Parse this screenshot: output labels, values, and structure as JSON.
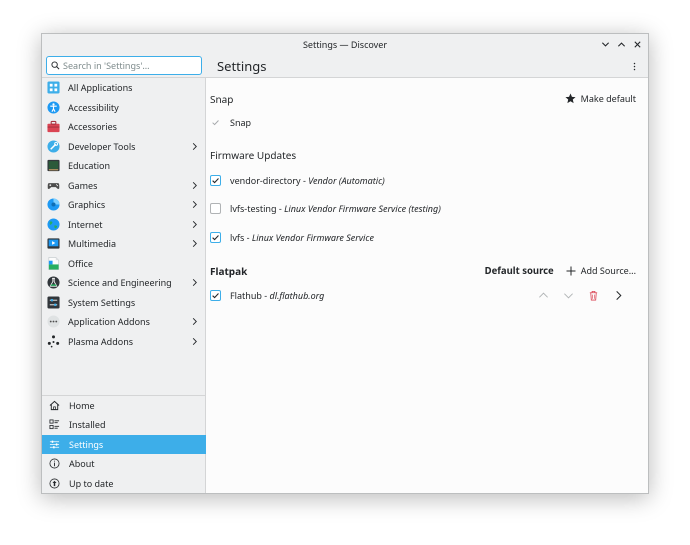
{
  "window": {
    "title": "Settings — Discover"
  },
  "header": {
    "search_placeholder": "Search in 'Settings'...",
    "page_title": "Settings"
  },
  "sidebar": {
    "categories": [
      {
        "label": "All Applications",
        "icon": "all-applications-icon",
        "has_children": false
      },
      {
        "label": "Accessibility",
        "icon": "accessibility-icon",
        "has_children": false
      },
      {
        "label": "Accessories",
        "icon": "accessories-icon",
        "has_children": false
      },
      {
        "label": "Developer Tools",
        "icon": "developer-tools-icon",
        "has_children": true
      },
      {
        "label": "Education",
        "icon": "education-icon",
        "has_children": false
      },
      {
        "label": "Games",
        "icon": "games-icon",
        "has_children": true
      },
      {
        "label": "Graphics",
        "icon": "graphics-icon",
        "has_children": true
      },
      {
        "label": "Internet",
        "icon": "internet-icon",
        "has_children": true
      },
      {
        "label": "Multimedia",
        "icon": "multimedia-icon",
        "has_children": true
      },
      {
        "label": "Office",
        "icon": "office-icon",
        "has_children": false
      },
      {
        "label": "Science and Engineering",
        "icon": "science-icon",
        "has_children": true
      },
      {
        "label": "System Settings",
        "icon": "system-settings-icon",
        "has_children": false
      },
      {
        "label": "Application Addons",
        "icon": "application-addons-icon",
        "has_children": true
      },
      {
        "label": "Plasma Addons",
        "icon": "plasma-addons-icon",
        "has_children": true
      }
    ],
    "nav": [
      {
        "label": "Home",
        "icon": "home-icon",
        "active": false
      },
      {
        "label": "Installed",
        "icon": "installed-icon",
        "active": false
      },
      {
        "label": "Settings",
        "icon": "settings-icon",
        "active": true
      },
      {
        "label": "About",
        "icon": "about-icon",
        "active": false
      },
      {
        "label": "Up to date",
        "icon": "up-to-date-icon",
        "active": false
      }
    ]
  },
  "main": {
    "snap": {
      "title": "Snap",
      "make_default_label": "Make default",
      "sources": [
        {
          "name": "Snap",
          "checked": true,
          "disabled": true
        }
      ]
    },
    "firmware": {
      "title": "Firmware Updates",
      "sources": [
        {
          "name": "vendor-directory",
          "separator": " - ",
          "detail": "Vendor (Automatic)",
          "checked": true
        },
        {
          "name": "lvfs-testing",
          "separator": " - ",
          "detail": "Linux Vendor Firmware Service (testing)",
          "checked": false
        },
        {
          "name": "lvfs",
          "separator": " - ",
          "detail": "Linux Vendor Firmware Service",
          "checked": true
        }
      ]
    },
    "flatpak": {
      "title": "Flatpak",
      "default_source_label": "Default source",
      "add_source_label": "Add Source...",
      "sources": [
        {
          "name": "Flathub",
          "separator": " - ",
          "detail": "dl.flathub.org",
          "checked": true
        }
      ]
    }
  },
  "colors": {
    "accent": "#3daee9",
    "delete": "#da4453"
  }
}
